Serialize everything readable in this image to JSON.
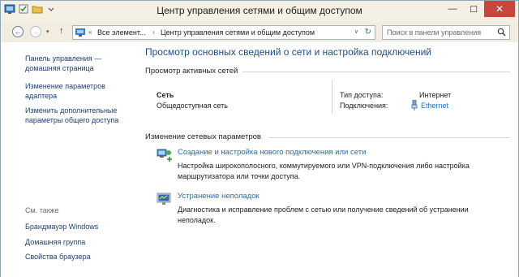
{
  "window": {
    "title": "Центр управления сетями и общим доступом",
    "controls": {
      "minimize": "—",
      "maximize": "☐",
      "close": "✕"
    }
  },
  "address": {
    "back_icon": "arrow-left-icon",
    "forward_icon": "arrow-right-icon",
    "crumbs": [
      "Все элемент...",
      "Центр управления сетями и общим доступом"
    ],
    "search_placeholder": "Поиск в панели управления"
  },
  "sidebar": {
    "home_link": "Панель управления — домашняя страница",
    "adapter_link": "Изменение параметров адаптера",
    "sharing_link": "Изменить дополнительные параметры общего доступа",
    "see_also_label": "См. также",
    "see_also": [
      "Брандмауэр Windows",
      "Домашняя группа",
      "Свойства браузера"
    ]
  },
  "main": {
    "title": "Просмотр основных сведений о сети и настройка подключений",
    "active_networks_head": "Просмотр активных сетей",
    "network": {
      "name": "Сеть",
      "type": "Общедоступная сеть",
      "access_label": "Тип доступа:",
      "access_value": "Интернет",
      "connections_label": "Подключения:",
      "connection_value": "Ethernet"
    },
    "change_settings_head": "Изменение сетевых параметров",
    "tasks": [
      {
        "icon": "network-setup-icon",
        "link": "Создание и настройка нового подключения или сети",
        "desc": "Настройка широкополосного, коммутируемого или VPN-подключения либо настройка маршрутизатора или точки доступа."
      },
      {
        "icon": "troubleshoot-icon",
        "link": "Устранение неполадок",
        "desc": "Диагностика и исправление проблем с сетью или получение сведений об устранении неполадок."
      }
    ]
  }
}
